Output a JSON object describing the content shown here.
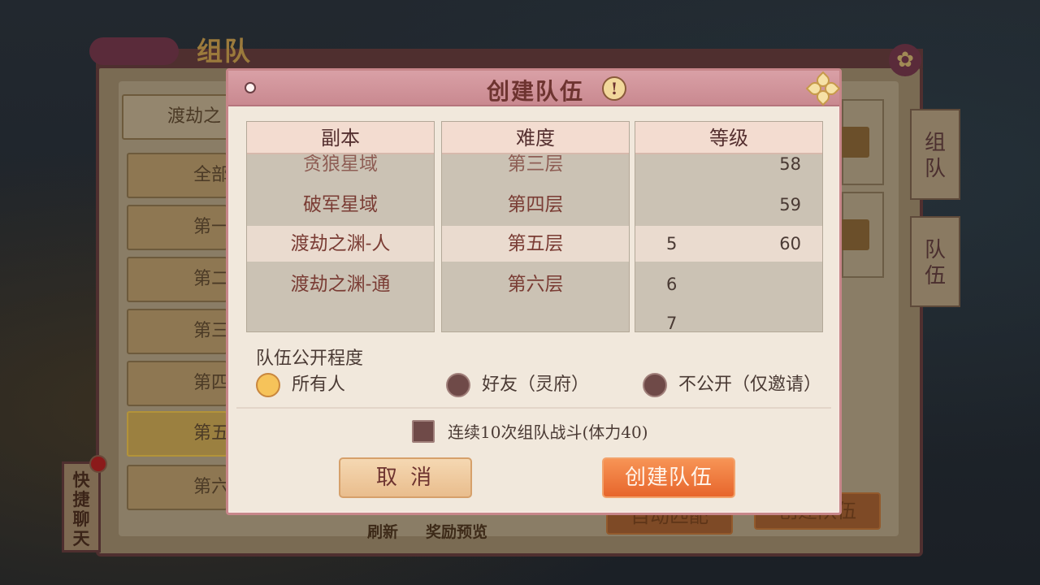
{
  "background": {
    "panel_title": "组队",
    "list_items": [
      "渡劫之",
      "全部",
      "第一",
      "第二",
      "第三",
      "第四",
      "第五",
      "第六"
    ],
    "side_tabs": [
      "组\n队",
      "队\n伍"
    ],
    "auto_match_label": "自动匹配",
    "create_team_label": "创建队伍",
    "refresh_label": "刷新",
    "reward_preview_label": "奖励预览",
    "quick_chat_label": "快\n捷\n聊\n天"
  },
  "dialog": {
    "title": "创建队伍",
    "info_icon": "!",
    "columns": {
      "dungeon": {
        "header": "副本",
        "options": [
          "贪狼星域",
          "破军星域",
          "渡劫之渊-人",
          "渡劫之渊-通"
        ],
        "selected": "渡劫之渊-人"
      },
      "difficulty": {
        "header": "难度",
        "options": [
          "第三层",
          "第四层",
          "第五层",
          "第六层"
        ],
        "selected": "第五层"
      },
      "level": {
        "header": "等级",
        "min_options": [
          "5",
          "6",
          "7"
        ],
        "max_options": [
          "58",
          "59",
          "60"
        ],
        "selected_min": "5",
        "selected_max": "60"
      }
    },
    "visibility": {
      "label": "队伍公开程度",
      "options": [
        "所有人",
        "好友（灵府）",
        "不公开（仅邀请）"
      ],
      "selected": "所有人"
    },
    "continuous_battle_label": "连续10次组队战斗(体力40)",
    "continuous_battle_checked": false,
    "cancel_label": "取 消",
    "create_label": "创建队伍"
  }
}
